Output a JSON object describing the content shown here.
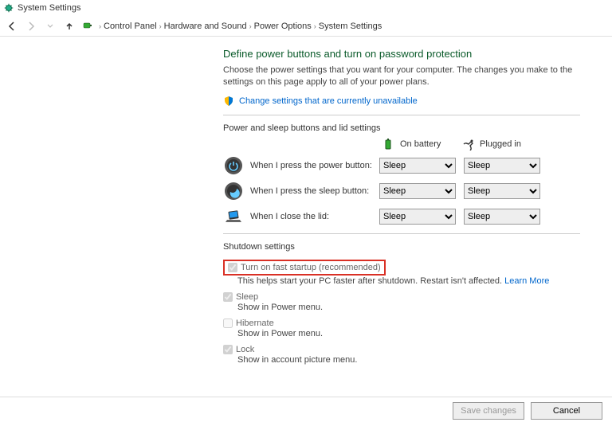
{
  "window": {
    "title": "System Settings"
  },
  "breadcrumb": {
    "items": [
      "Control Panel",
      "Hardware and Sound",
      "Power Options",
      "System Settings"
    ]
  },
  "main": {
    "heading": "Define power buttons and turn on password protection",
    "subtext": "Choose the power settings that you want for your computer. The changes you make to the settings on this page apply to all of your power plans.",
    "change_link": "Change settings that are currently unavailable",
    "power_section_label": "Power and sleep buttons and lid settings",
    "col_battery": "On battery",
    "col_plugged": "Plugged in",
    "rows": [
      {
        "label": "When I press the power button:",
        "battery": "Sleep",
        "plugged": "Sleep"
      },
      {
        "label": "When I press the sleep button:",
        "battery": "Sleep",
        "plugged": "Sleep"
      },
      {
        "label": "When I close the lid:",
        "battery": "Sleep",
        "plugged": "Sleep"
      }
    ],
    "shutdown_label": "Shutdown settings",
    "fast_startup": {
      "label": "Turn on fast startup (recommended)",
      "sub": "This helps start your PC faster after shutdown. Restart isn't affected.",
      "learn": "Learn More"
    },
    "sleep": {
      "label": "Sleep",
      "sub": "Show in Power menu."
    },
    "hibernate": {
      "label": "Hibernate",
      "sub": "Show in Power menu."
    },
    "lock": {
      "label": "Lock",
      "sub": "Show in account picture menu."
    }
  },
  "footer": {
    "save": "Save changes",
    "cancel": "Cancel"
  }
}
